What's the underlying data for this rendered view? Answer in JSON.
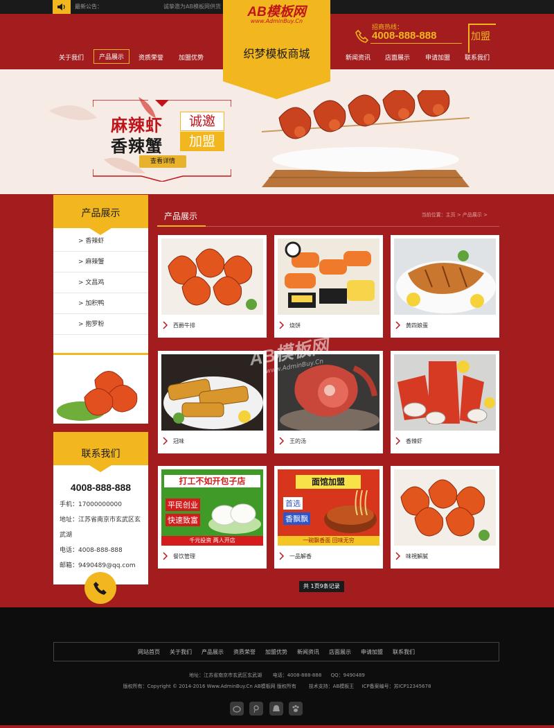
{
  "notice": {
    "label": "最新公告：",
    "text": "诚挚邀为AB模板网供货"
  },
  "logo": {
    "main": "AB模板网",
    "sub": "www.AdminBuy.Cn",
    "title": "织梦模板商城"
  },
  "nav": {
    "left": [
      "关于我们",
      "产品展示",
      "资质荣誉",
      "加盟优势"
    ],
    "right": [
      "新闻资讯",
      "店面展示",
      "申请加盟",
      "联系我们"
    ],
    "active": "产品展示"
  },
  "hotline": {
    "label": "招商热线：",
    "number": "4008-888-888",
    "join": "加盟"
  },
  "hero": {
    "line1": "麻辣虾",
    "line2": "香辣蟹",
    "tag1": "诚邀",
    "tag2": "加盟",
    "button": "查看详情"
  },
  "sidebar": {
    "products_title": "产品展示",
    "categories": [
      "香辣虾",
      "麻辣蟹",
      "文昌鸡",
      "加积鸭",
      "抱罗粉"
    ],
    "contact_title": "联系我们",
    "contact_phone": "4008-888-888",
    "contact_lines": [
      "手机：17000000000",
      "地址：江苏省南京市玄武区玄",
      "武湖",
      "电话：4008-888-888",
      "邮箱：9490489@qq.com"
    ]
  },
  "main": {
    "title": "产品展示",
    "breadcrumb": "当前位置：主页 > 产品展示 >",
    "products": [
      {
        "name": "西爵牛排",
        "icon": "shrimp-photo"
      },
      {
        "name": "烧饼",
        "icon": "sushi-photo"
      },
      {
        "name": "黄四娘蛋",
        "icon": "grilled-fish-photo"
      },
      {
        "name": "冠味",
        "icon": "fried-fish-photo"
      },
      {
        "name": "王的汤",
        "icon": "crab-photo"
      },
      {
        "name": "香辣虾",
        "icon": "seafood-platter-photo"
      },
      {
        "name": "餐饮管理",
        "icon": "bun-ad-photo"
      },
      {
        "name": "一品解香",
        "icon": "noodle-ad-photo"
      },
      {
        "name": "味視解膩",
        "icon": "shrimp-photo"
      }
    ],
    "ad1": {
      "title": "打工不如开包子店",
      "tag1": "平民创业",
      "tag2": "快速致富",
      "slogan": "千元投资 两人开店"
    },
    "ad2": {
      "title": "面馆加盟",
      "tag1": "首选",
      "tag2": "香飘飘",
      "slogan": "一碗飘香面 回味无穷"
    },
    "pager": "共 1页9条记录"
  },
  "watermark": {
    "main": "AB模板网",
    "sub": "www.AdminBuy.Cn"
  },
  "footer": {
    "nav": [
      "网站首页",
      "关于我们",
      "产品展示",
      "资质荣誉",
      "加盟优势",
      "新闻资讯",
      "店面展示",
      "申请加盟",
      "联系我们"
    ],
    "address": "地址：江苏省南京市玄武区玄武湖",
    "phone": "电话：4008-888-888",
    "qq": "QQ：9490489",
    "copyright": "版权所有：Copyright © 2014-2016 Www.AdminBuy.Cn AB模板网 版权所有",
    "support": "技术支持：AB模板王",
    "icp": "ICP备案编号：苏ICP12345678"
  },
  "colors": {
    "primary": "#a31c1e",
    "accent": "#f2b61e",
    "dark": "#0d0d0d"
  }
}
